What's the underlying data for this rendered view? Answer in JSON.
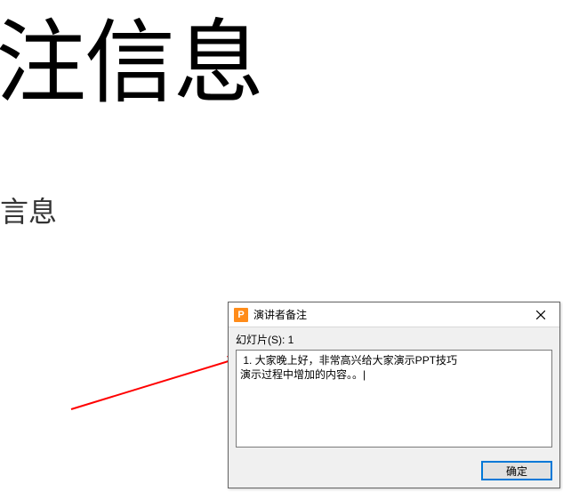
{
  "background": {
    "title": "注信息",
    "subtitle": "言息"
  },
  "dialog": {
    "title": "演讲者备注",
    "icon_letter": "P",
    "slide_label": "幻灯片(S): 1",
    "notes_text": " 1. 大家晚上好，非常高兴给大家演示PPT技巧\n演示过程中增加的内容。。|",
    "ok_label": "确定"
  }
}
